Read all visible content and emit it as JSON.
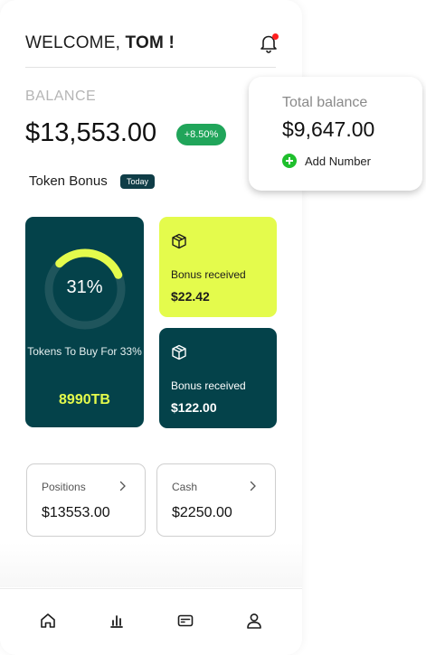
{
  "header": {
    "welcome_prefix": "WELCOME,",
    "user_name": "TOM !"
  },
  "balance": {
    "label": "BALANCE",
    "value": "$13,553.00",
    "change": "+8.50%"
  },
  "token_bonus": {
    "title": "Token Bonus",
    "tag": "Today",
    "progress_label": "31%",
    "progress": 0.31,
    "caption": "Tokens To Buy For 33%",
    "amount": "8990TB"
  },
  "bonus_cards": [
    {
      "label": "Bonus received",
      "value": "$22.42",
      "icon": "package-icon"
    },
    {
      "label": "Bonus received",
      "value": "$122.00",
      "icon": "package-icon"
    }
  ],
  "summary_cards": [
    {
      "title": "Positions",
      "value": "$13553.00"
    },
    {
      "title": "Cash",
      "value": "$2250.00"
    }
  ],
  "total_balance": {
    "label": "Total balance",
    "value": "$9,647.00",
    "add_label": "Add Number"
  },
  "nav": [
    "home-icon",
    "chart-icon",
    "card-icon",
    "user-icon"
  ],
  "colors": {
    "teal": "#04424a",
    "lime": "#e4fb4c",
    "green": "#20a55a",
    "notification": "#ff1e1e"
  }
}
